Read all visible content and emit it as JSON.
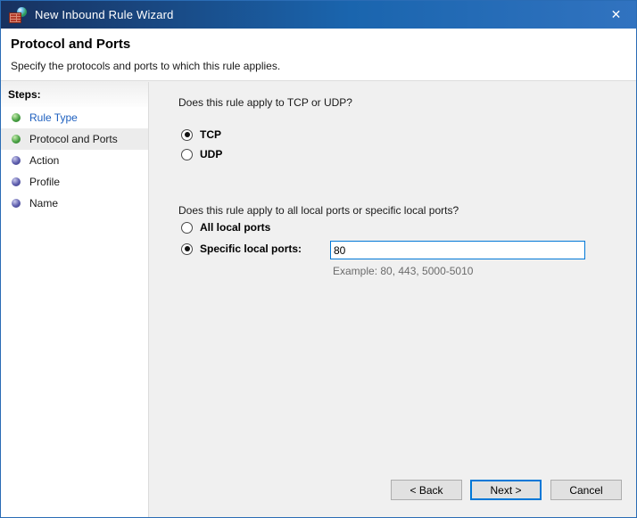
{
  "window": {
    "title": "New Inbound Rule Wizard",
    "close_icon": "✕"
  },
  "header": {
    "title": "Protocol and Ports",
    "subtitle": "Specify the protocols and ports to which this rule applies."
  },
  "sidebar": {
    "heading": "Steps:",
    "items": [
      {
        "label": "Rule Type",
        "state": "visited"
      },
      {
        "label": "Protocol and Ports",
        "state": "current"
      },
      {
        "label": "Action",
        "state": "upcoming"
      },
      {
        "label": "Profile",
        "state": "upcoming"
      },
      {
        "label": "Name",
        "state": "upcoming"
      }
    ]
  },
  "main": {
    "question1": "Does this rule apply to TCP or UDP?",
    "radio_tcp": {
      "label": "TCP",
      "selected": true
    },
    "radio_udp": {
      "label": "UDP",
      "selected": false
    },
    "question2": "Does this rule apply to all local ports or specific local ports?",
    "radio_all_ports": {
      "label": "All local ports",
      "selected": false
    },
    "radio_specific_ports": {
      "label": "Specific local ports:",
      "selected": true
    },
    "ports_value": "80",
    "example": "Example: 80, 443, 5000-5010"
  },
  "footer": {
    "back": "< Back",
    "next": "Next >",
    "cancel": "Cancel"
  },
  "colors": {
    "titlebar_gradient_start": "#18315f",
    "titlebar_gradient_end": "#3173c0",
    "accent_focus": "#0078d7",
    "main_background": "#f0f0f0",
    "sidebar_background": "#ffffff",
    "current_step_highlight": "#ececec",
    "visited_step_link": "#1d5fbf",
    "step_bullet_green": "#4aa245",
    "step_bullet_purple": "#5c5cac"
  }
}
